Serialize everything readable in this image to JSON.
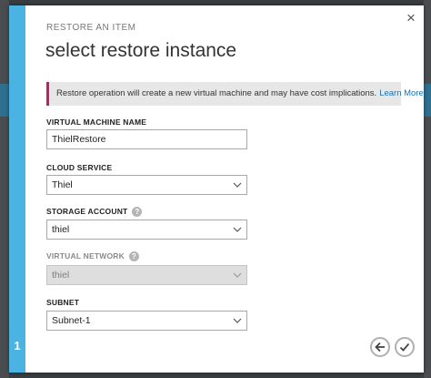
{
  "dialog": {
    "step": "1",
    "subtitle": "RESTORE AN ITEM",
    "title": "select restore instance",
    "close_glyph": "×"
  },
  "notice": {
    "text": "Restore operation will create a new virtual machine and may have cost implications.",
    "link": "Learn More",
    "accent_color": "#c31b6d"
  },
  "fields": {
    "vm_name": {
      "label": "VIRTUAL MACHINE NAME",
      "value": "ThielRestore"
    },
    "cloud_service": {
      "label": "CLOUD SERVICE",
      "value": "Thiel"
    },
    "storage_account": {
      "label": "STORAGE ACCOUNT",
      "value": "thiel",
      "help": "?"
    },
    "virtual_network": {
      "label": "VIRTUAL NETWORK",
      "value": "thiel",
      "help": "?",
      "disabled": true
    },
    "subnet": {
      "label": "SUBNET",
      "value": "Subnet-1"
    }
  },
  "footer": {
    "back_icon": "arrow-left-icon",
    "confirm_icon": "checkmark-icon"
  },
  "colors": {
    "rail": "#4ab3e1",
    "link": "#1a73b8"
  }
}
